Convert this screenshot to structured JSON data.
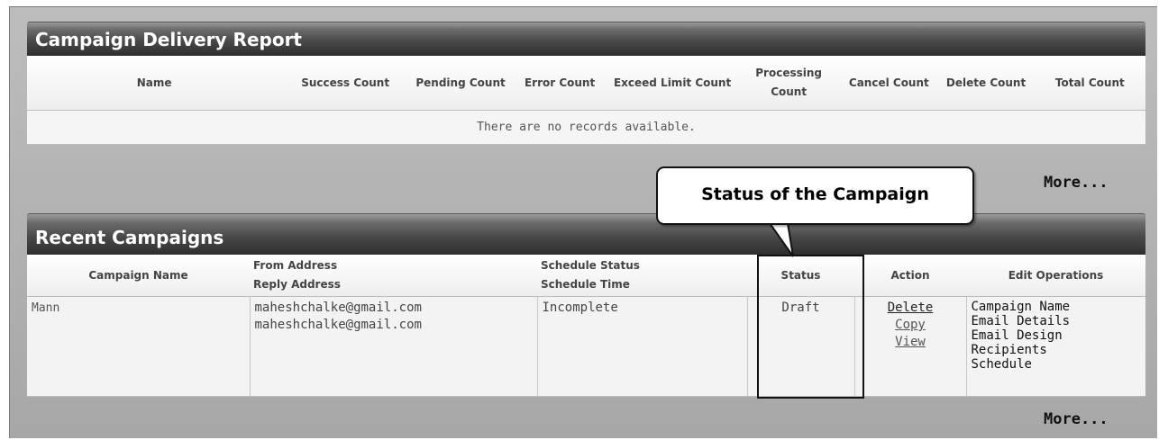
{
  "delivery_report": {
    "title": "Campaign Delivery Report",
    "columns": [
      "Name",
      "Success Count",
      "Pending Count",
      "Error Count",
      "Exceed Limit Count",
      "Processing Count",
      "Cancel Count",
      "Delete Count",
      "Total Count"
    ],
    "empty_message": "There are no records available.",
    "more_link": "More..."
  },
  "recent_campaigns": {
    "title": "Recent Campaigns",
    "columns": {
      "campaign_name": "Campaign Name",
      "from_address": "From Address",
      "reply_address": "Reply Address",
      "schedule_status": "Schedule Status",
      "schedule_time": "Schedule Time",
      "status": "Status",
      "action": "Action",
      "edit_operations": "Edit Operations"
    },
    "rows": [
      {
        "campaign_name": "Mann",
        "from_address": "maheshchalke@gmail.com",
        "reply_address": "maheshchalke@gmail.com",
        "schedule_status": "Incomplete",
        "status": "Draft",
        "actions": [
          "Delete",
          "Copy",
          "View"
        ],
        "edit_operations": [
          "Campaign Name",
          "Email Details",
          "Email Design",
          "Recipients",
          "Schedule"
        ]
      }
    ],
    "more_link": "More..."
  },
  "annotation": {
    "callout_text": "Status of the Campaign"
  }
}
